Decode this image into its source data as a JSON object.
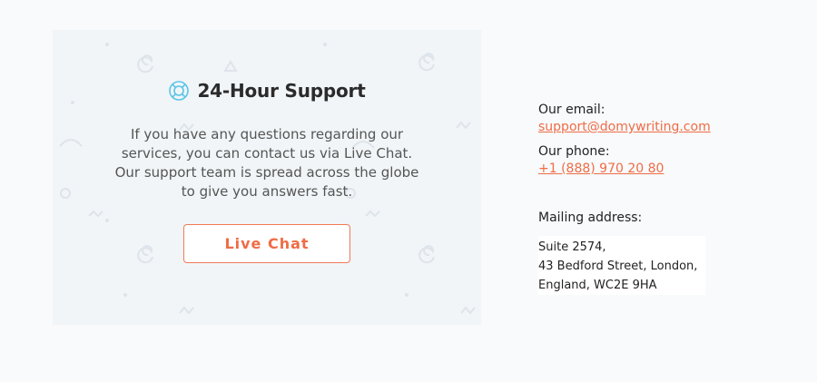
{
  "support": {
    "icon": "lifebuoy-icon",
    "title": "24-Hour Support",
    "description": "If you have any questions regarding our services, you can contact us via Live Chat. Our support team is spread across the globe to give you answers fast.",
    "button_label": "Live Chat"
  },
  "contact": {
    "email_label": "Our email:",
    "email": "support@domywriting.com",
    "phone_label": "Our phone:",
    "phone": "+1 (888) 970 20 80",
    "mailing_label": "Mailing address:",
    "address_lines": [
      "Suite 2574,",
      "43 Bedford Street, London,",
      "England, WC2E 9HA"
    ]
  },
  "colors": {
    "accent": "#ef6c45",
    "card_bg": "#f1f5f8",
    "icon": "#5bc4e8"
  }
}
